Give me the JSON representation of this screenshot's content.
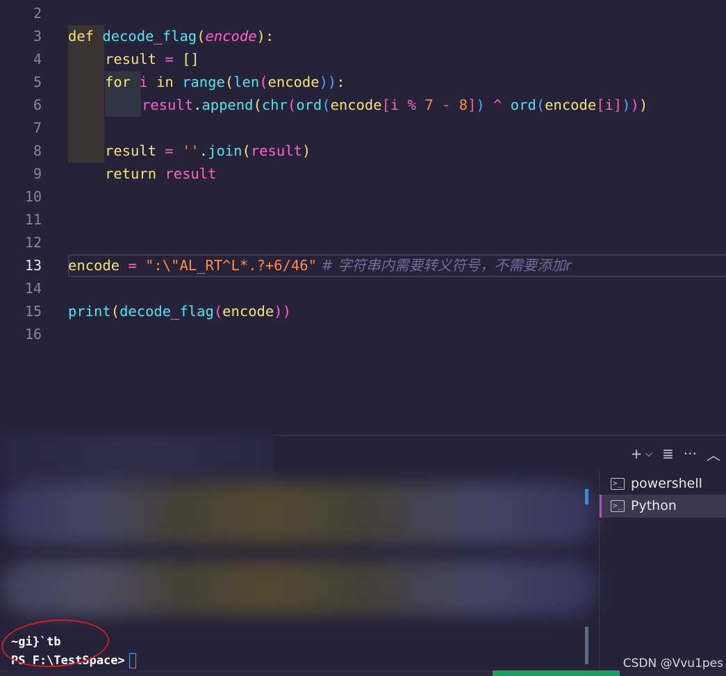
{
  "editor": {
    "lines": [
      {
        "num": "2"
      },
      {
        "num": "3"
      },
      {
        "num": "4"
      },
      {
        "num": "5"
      },
      {
        "num": "6"
      },
      {
        "num": "7"
      },
      {
        "num": "8"
      },
      {
        "num": "9"
      },
      {
        "num": "10"
      },
      {
        "num": "11"
      },
      {
        "num": "12"
      },
      {
        "num": "13"
      },
      {
        "num": "14"
      },
      {
        "num": "15"
      },
      {
        "num": "16"
      }
    ],
    "code": {
      "l2": {
        "def": "def",
        "name": "decode_flag",
        "p1": "(",
        "param": "encode",
        "p2": "):"
      },
      "l3": {
        "var": "result",
        "eq": " = ",
        "val": "[]"
      },
      "l4": {
        "for": "for",
        "i": " i ",
        "in": "in",
        "range": " range",
        "p1": "(",
        "len": "len",
        "p2": "(",
        "arg": "encode",
        "p3": "))",
        "colon": ":"
      },
      "l5": {
        "obj": "result",
        "dot": ".",
        "method": "append",
        "p1": "(",
        "chr": "chr",
        "p2": "(",
        "ord1": "ord",
        "p3": "(",
        "enc1": "encode",
        "b1": "[",
        "expr_i": "i",
        "mod": " % ",
        "seven": "7",
        "minus": " - ",
        "eight": "8",
        "b2": "]",
        "p4": ")",
        "xor": " ^ ",
        "ord2": "ord",
        "p5": "(",
        "enc2": "encode",
        "b3": "[",
        "i2": "i",
        "b4": "]",
        "p6": ")",
        "p7": ")",
        "p8": ")"
      },
      "l7": {
        "var": "result",
        "eq": " = ",
        "str": "''",
        "dot": ".",
        "join": "join",
        "p1": "(",
        "arg": "result",
        "p2": ")"
      },
      "l8": {
        "ret": "return",
        "val": " result"
      },
      "l12": {
        "var": "encode",
        "eq": " = ",
        "str": "\":\\\"AL_RT^L*.?+6/46\"",
        "comment": " # 字符串内需要转义符号，不需要添加r"
      },
      "l14": {
        "print": "print",
        "p1": "(",
        "fn": "decode_flag",
        "p2": "(",
        "arg": "encode",
        "p3": "))"
      }
    }
  },
  "panel": {
    "toolbar": {
      "add": "+",
      "chevron": "⌵",
      "clear": "≣",
      "more": "···",
      "collapse": "︿"
    },
    "terminals": [
      {
        "label": "powershell",
        "icon": ">_"
      },
      {
        "label": "Python",
        "icon": ">_"
      }
    ],
    "output_line": "~gi}`tb",
    "prompt": "PS F:\\TestSpace>"
  },
  "watermark": "CSDN @Vvu1pes",
  "colors": {
    "background": "#25223a",
    "keyword": "#f7e36f",
    "function": "#54e3f0",
    "string": "#ff8b45",
    "annotation": "#d01f25",
    "status_green": "#1e9e5f"
  }
}
